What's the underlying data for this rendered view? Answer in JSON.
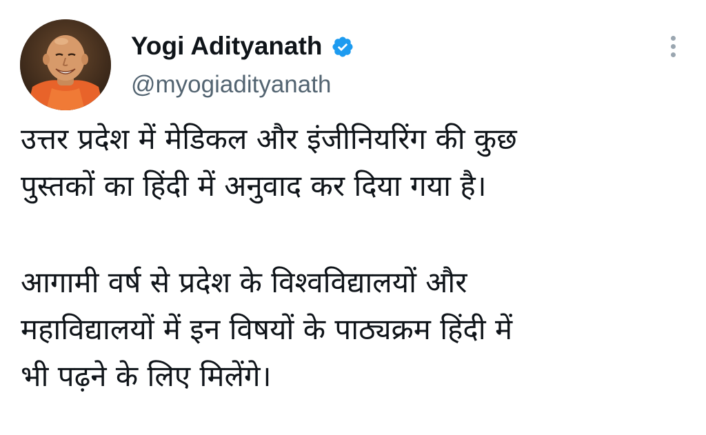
{
  "author": {
    "name": "Yogi Adityanath",
    "handle": "@myogiadityanath",
    "verified_icon": "verified-badge-icon",
    "badge_color": "#1d9bf0"
  },
  "actions": {
    "more_icon": "more-vertical-icon"
  },
  "tweet": {
    "paragraphs": [
      {
        "lines": [
          "उत्तर प्रदेश में मेडिकल और इंजीनियरिंग की कुछ",
          "पुस्तकों का हिंदी में अनुवाद कर दिया गया है।"
        ]
      },
      {
        "lines": [
          "आगामी वर्ष से प्रदेश के विश्वविद्यालयों और",
          "महाविद्यालयों में इन विषयों के पाठ्यक्रम हिंदी में",
          "भी पढ़ने के लिए मिलेंगे।"
        ]
      }
    ]
  },
  "colors": {
    "text": "#0f1419",
    "secondary_text": "#536471",
    "background": "#ffffff"
  }
}
